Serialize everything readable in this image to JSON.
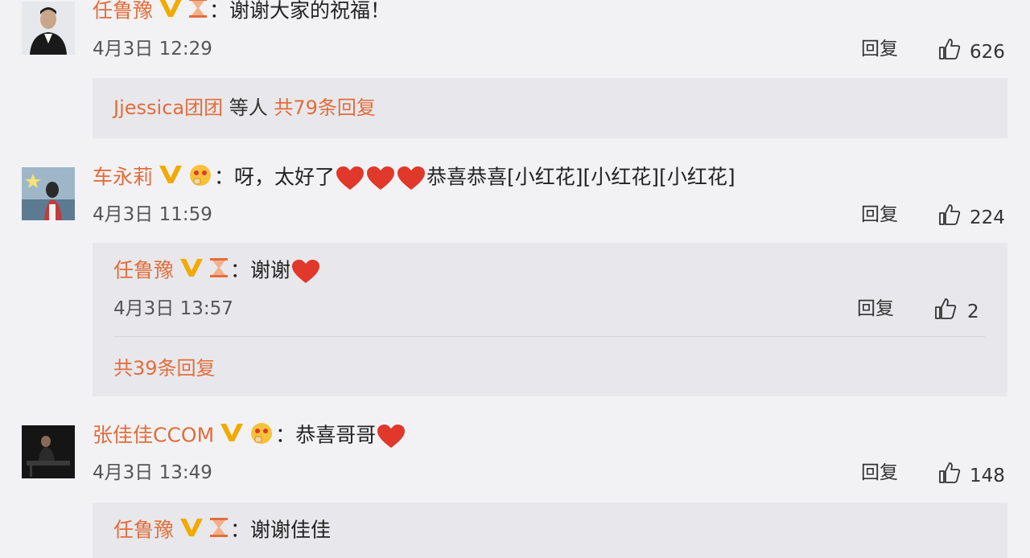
{
  "comments": [
    {
      "user": "任鲁豫",
      "sep": "：",
      "text": "谢谢大家的祝福！",
      "date": "4月3日 12:29",
      "reply_label": "回复",
      "likes": "626",
      "summary": {
        "names": "Jjessica团团",
        "mid": " 等人 ",
        "count": "共79条回复"
      }
    },
    {
      "user": "车永莉",
      "sep": "：",
      "text_a": "呀，太好了",
      "text_b": "恭喜恭喜[小红花][小红花][小红花]",
      "date": "4月3日 11:59",
      "reply_label": "回复",
      "likes": "224",
      "reply": {
        "user": "任鲁豫",
        "sep": "：",
        "text": "谢谢",
        "date": "4月3日 13:57",
        "reply_label": "回复",
        "likes": "2"
      },
      "more": "共39条回复"
    },
    {
      "user": "张佳佳CCOM",
      "sep": "：",
      "text": "恭喜哥哥",
      "date": "4月3日 13:49",
      "reply_label": "回复",
      "likes": "148",
      "reply": {
        "user": "任鲁豫",
        "sep": "：",
        "text": "谢谢佳佳"
      }
    }
  ],
  "colors": {
    "username": "#e26d3a",
    "vip_badge": "#f2a900",
    "heart": "#e0382b",
    "sub_bg": "#e8e8ec"
  }
}
